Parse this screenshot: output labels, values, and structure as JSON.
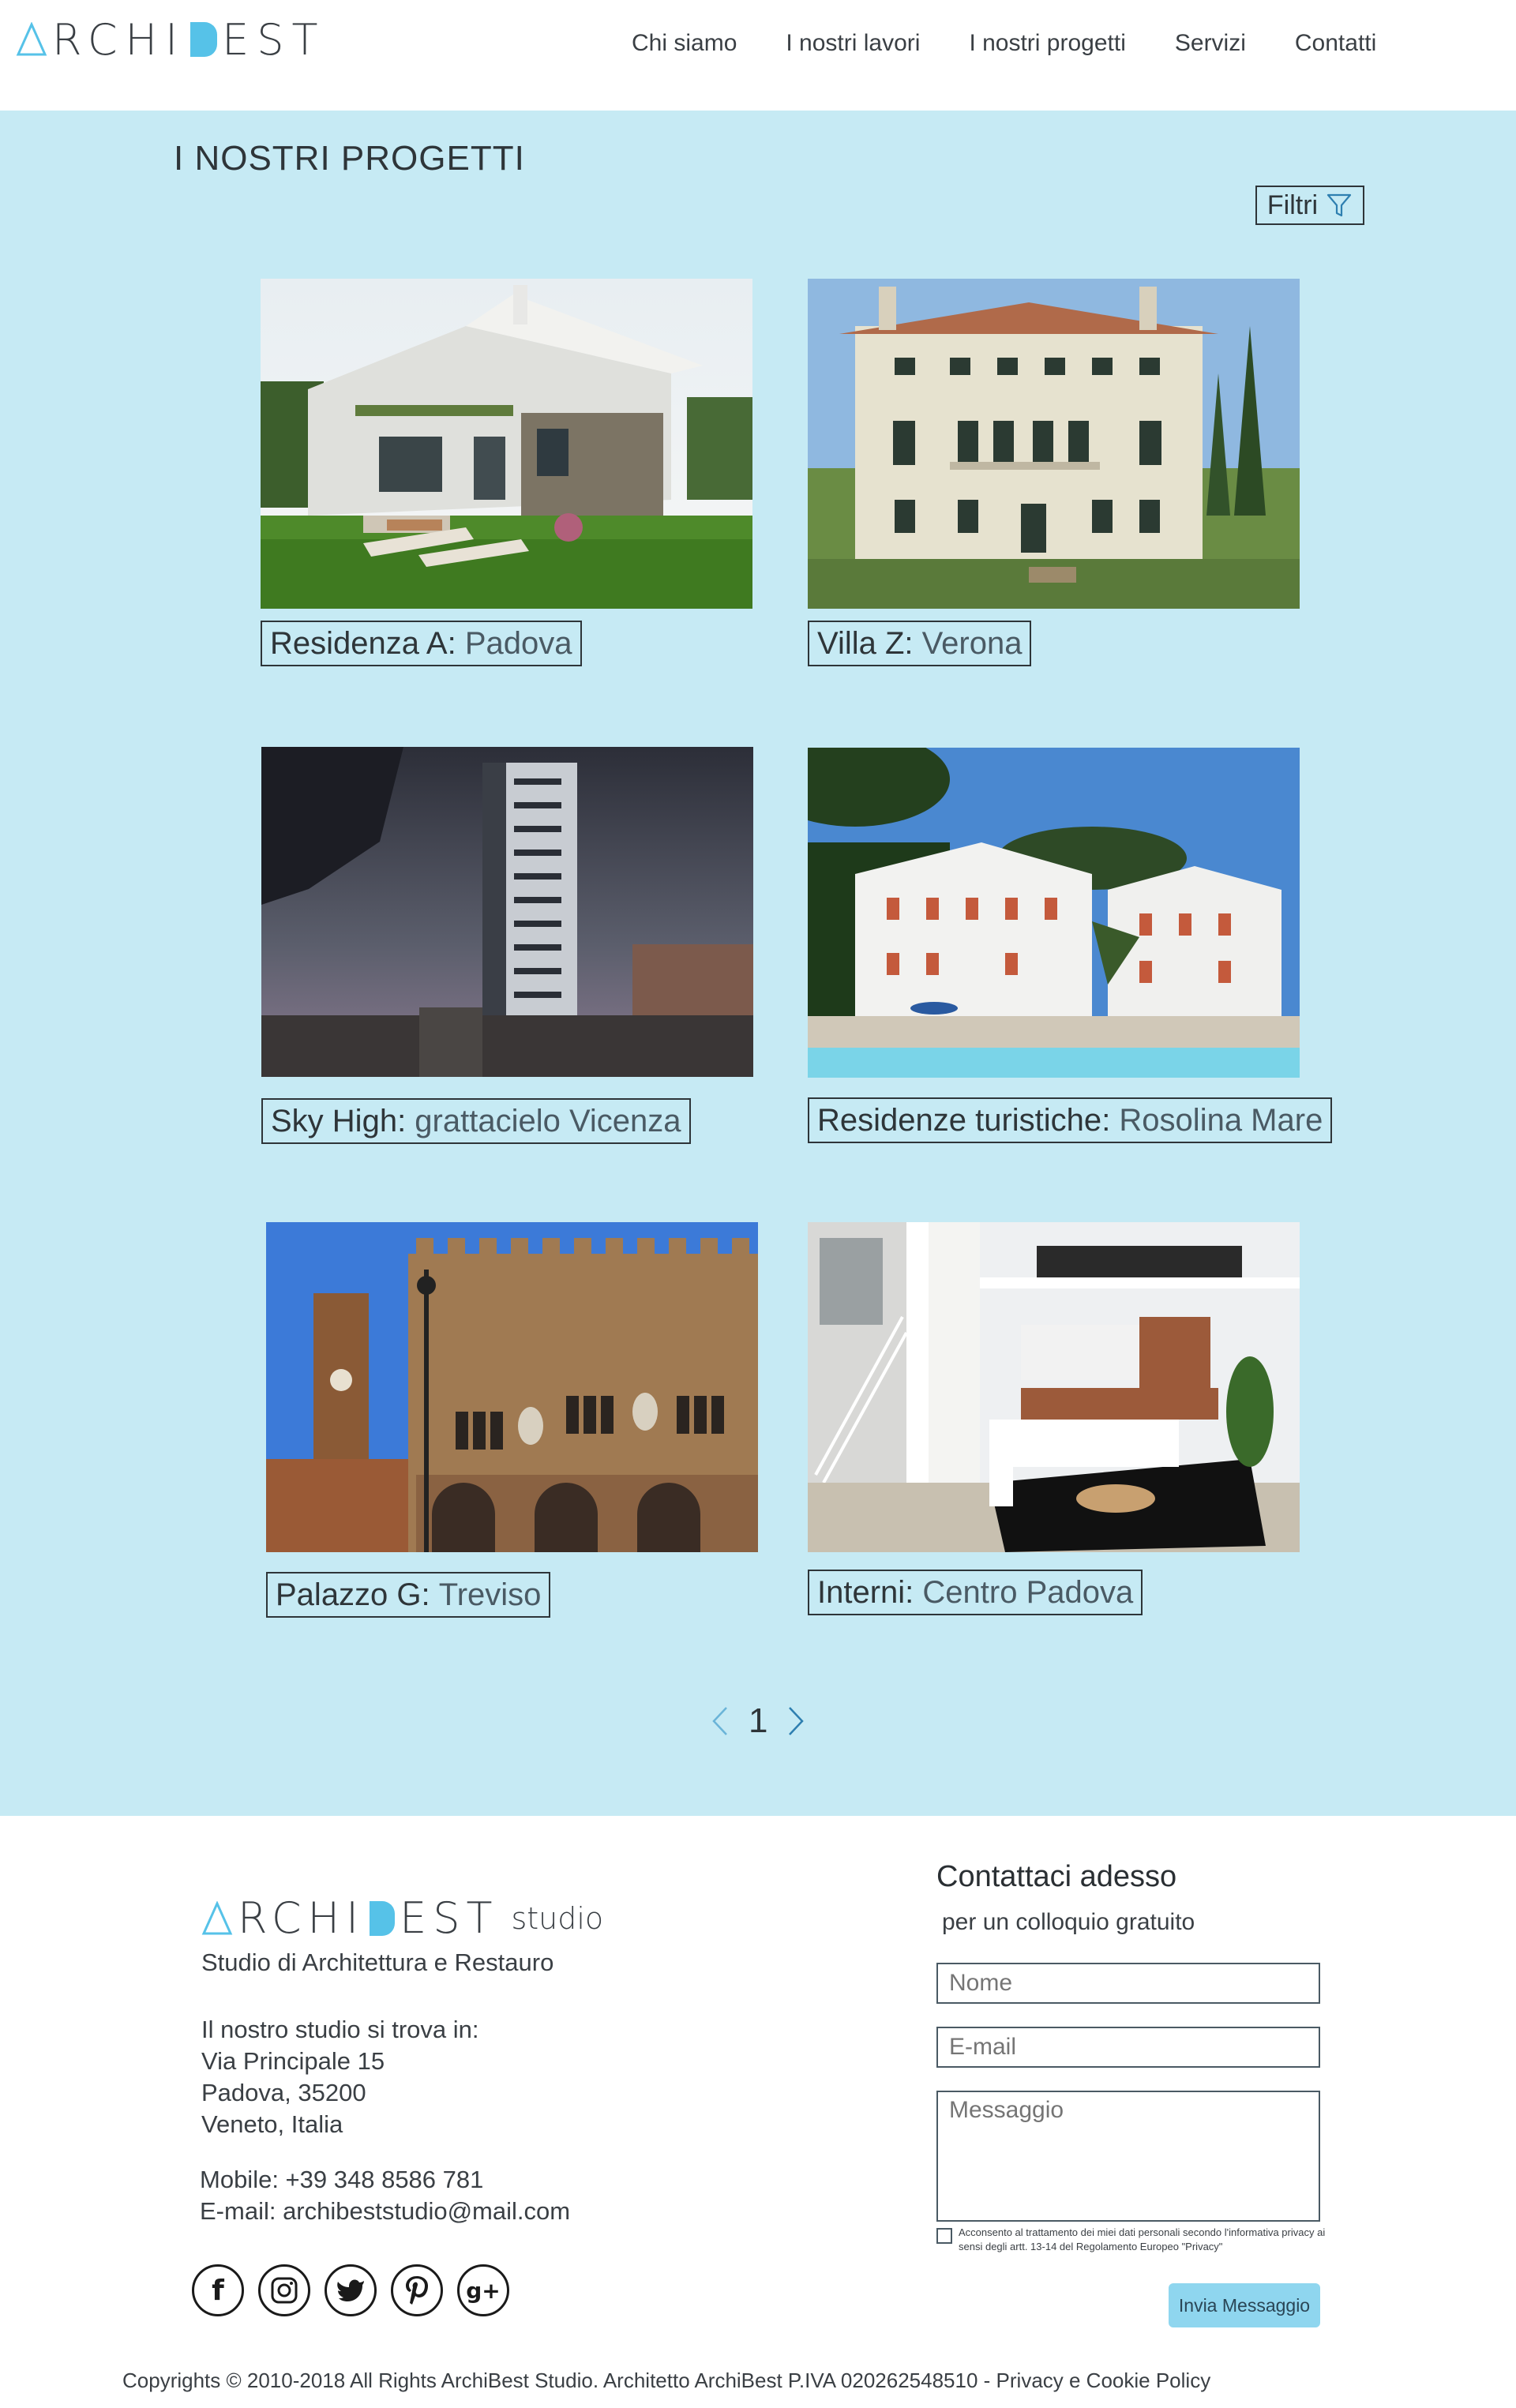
{
  "header": {
    "logo_text_a": "RCHI",
    "logo_text_b": "EST",
    "nav": [
      "Chi siamo",
      "I nostri lavori",
      "I nostri progetti",
      "Servizi",
      "Contatti"
    ]
  },
  "projects": {
    "title": "I NOSTRI PROGETTI",
    "filter_label": "Filtri",
    "items": [
      {
        "name": "Residenza A",
        "place": "Padova"
      },
      {
        "name": "Villa Z",
        "place": "Verona"
      },
      {
        "name": "Sky High",
        "place": "grattacielo Vicenza"
      },
      {
        "name": "Residenze turistiche",
        "place": "Rosolina Mare"
      },
      {
        "name": "Palazzo G",
        "place": "Treviso"
      },
      {
        "name": "Interni",
        "place": "Centro Padova"
      }
    ],
    "pager": {
      "current": "1"
    }
  },
  "footer": {
    "logo_suffix": "studio",
    "tagline": "Studio di Architettura e Restauro",
    "address_intro": "Il nostro studio si trova in:",
    "address_lines": [
      "Via Principale 15",
      "Padova, 35200",
      "Veneto, Italia"
    ],
    "mobile": "Mobile: +39 348 8586 781",
    "email": "E-mail: archibeststudio@mail.com",
    "social_icons": [
      "facebook-icon",
      "instagram-icon",
      "twitter-icon",
      "pinterest-icon",
      "google-plus-icon"
    ],
    "contact": {
      "title": "Contattaci adesso",
      "subtitle": "per un colloquio gratuito",
      "name_placeholder": "Nome",
      "email_placeholder": "E-mail",
      "message_placeholder": "Messaggio",
      "consent": "Acconsento al trattamento dei miei dati personali secondo l'informativa privacy ai sensi degli artt. 13-14 del Regolamento Europeo \"Privacy\"",
      "send_label": "Invia Messaggio"
    },
    "copyright": "Copyrights © 2010-2018 All Rights ArchiBest Studio.  Architetto ArchiBest P.IVA 020262548510 - Privacy e Cookie Policy"
  },
  "colors": {
    "accent": "#56c2e8",
    "section_bg": "#c6eaf4",
    "button_bg": "#8fd6ef"
  }
}
